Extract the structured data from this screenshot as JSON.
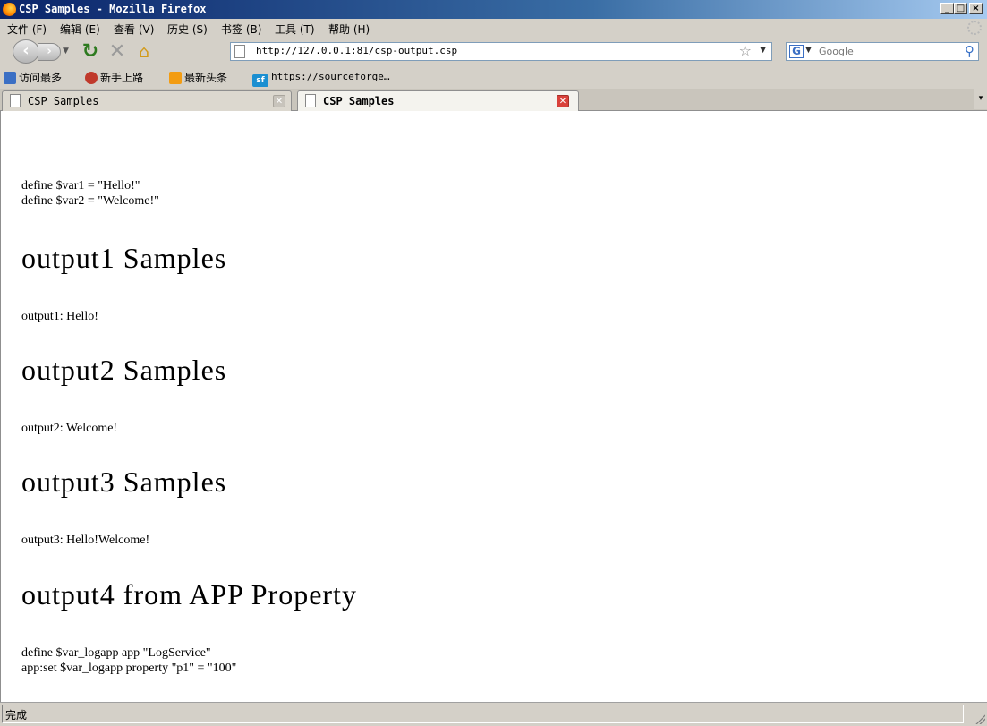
{
  "window": {
    "title": "CSP Samples - Mozilla Firefox",
    "controls": {
      "minimize": "_",
      "maximize": "□",
      "close": "×"
    }
  },
  "menu": [
    "文件 (F)",
    "编辑 (E)",
    "查看 (V)",
    "历史 (S)",
    "书签 (B)",
    "工具 (T)",
    "帮助 (H)"
  ],
  "nav": {
    "url": "http://127.0.0.1:81/csp-output.csp",
    "search_placeholder": "Google",
    "search_engine": "G"
  },
  "bookmarks": [
    {
      "label": "访问最多",
      "icon": "most-visited-icon",
      "color": "#3b6fc4"
    },
    {
      "label": "新手上路",
      "icon": "getting-started-icon",
      "color": "#c0392b"
    },
    {
      "label": "最新头条",
      "icon": "rss-feed-icon",
      "color": "#f39c12"
    },
    {
      "label": "https://sourceforge…",
      "icon": "sourceforge-icon",
      "color": "#1b8fd1",
      "icon_text": "sf"
    }
  ],
  "tabs": [
    {
      "label": "CSP Samples",
      "active": false
    },
    {
      "label": "CSP Samples",
      "active": true
    }
  ],
  "content": {
    "intro": [
      "define $var1 = \"Hello!\"",
      "define $var2 = \"Welcome!\""
    ],
    "sections": [
      {
        "heading": "output1 Samples",
        "lines": [
          "output1: Hello!"
        ]
      },
      {
        "heading": "output2 Samples",
        "lines": [
          "output2: Welcome!"
        ]
      },
      {
        "heading": "output3 Samples",
        "lines": [
          "output3: Hello!Welcome!"
        ]
      },
      {
        "heading": "output4 from APP Property",
        "lines": [
          "define $var_logapp app \"LogService\"",
          "app:set $var_logapp property \"p1\" = \"100\""
        ]
      }
    ]
  },
  "status": "完成",
  "colors": {
    "titlebar": "#0a246a",
    "chrome": "#d4d0c8",
    "reload": "#2d7a1f",
    "home": "#d29a1a",
    "tab_close_active": "#d9413a"
  }
}
